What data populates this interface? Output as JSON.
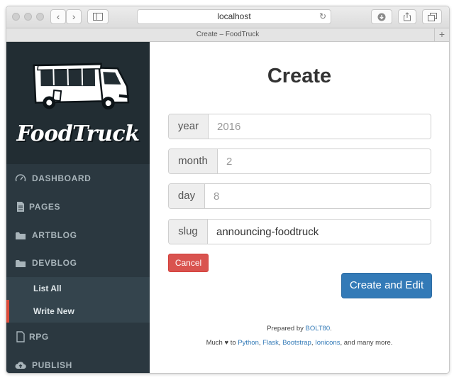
{
  "browser": {
    "url": "localhost",
    "tab_title": "Create – FoodTruck",
    "back": "‹",
    "forward": "›",
    "new_tab": "+"
  },
  "sidebar": {
    "brand": "FoodTruck",
    "items": [
      {
        "label": "DASHBOARD",
        "icon": "dashboard-gauge-icon"
      },
      {
        "label": "PAGES",
        "icon": "document-icon"
      },
      {
        "label": "ARTBLOG",
        "icon": "folder-icon"
      },
      {
        "label": "DEVBLOG",
        "icon": "folder-icon"
      },
      {
        "label": "RPG",
        "icon": "document-icon"
      },
      {
        "label": "PUBLISH",
        "icon": "cloud-upload-icon"
      }
    ],
    "devblog_sub": [
      {
        "label": "List All"
      },
      {
        "label": "Write New"
      }
    ]
  },
  "form": {
    "title": "Create",
    "fields": [
      {
        "label": "year",
        "value": "",
        "placeholder": "2016"
      },
      {
        "label": "month",
        "value": "",
        "placeholder": "2"
      },
      {
        "label": "day",
        "value": "",
        "placeholder": "8"
      },
      {
        "label": "slug",
        "value": "announcing-foodtruck",
        "placeholder": ""
      }
    ],
    "cancel_label": "Cancel",
    "submit_label": "Create and Edit"
  },
  "footer": {
    "prepared_prefix": "Prepared by ",
    "prepared_link": "BOLT80",
    "prepared_suffix": ".",
    "much": "Much ",
    "heart": "♥",
    "to": " to ",
    "links": [
      "Python",
      "Flask",
      "Bootstrap",
      "Ionicons"
    ],
    "sep": ", ",
    "suffix": ", and many more."
  },
  "colors": {
    "sidebar_bg": "#2b3840",
    "sidebar_logo_bg": "#222d33",
    "submenu_bg": "#34444d",
    "active_accent": "#dd4b39",
    "primary": "#337ab7",
    "danger": "#d9534f"
  }
}
